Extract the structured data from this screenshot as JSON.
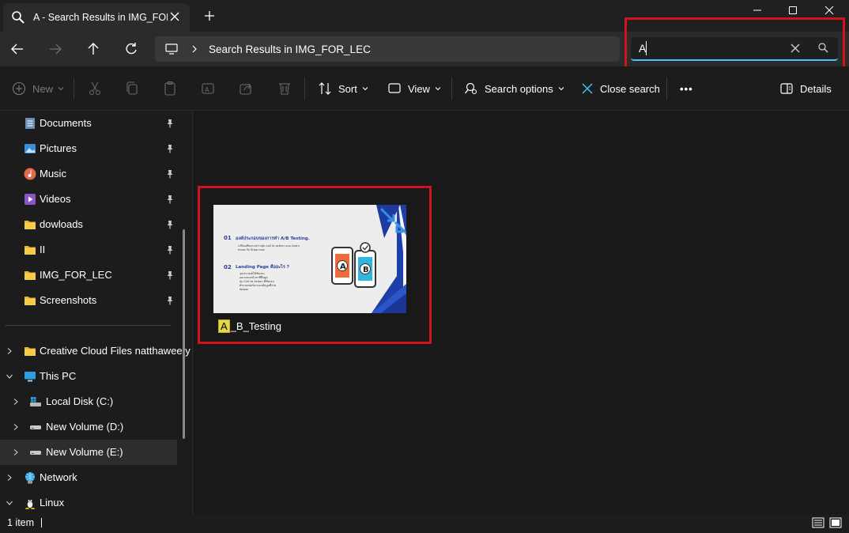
{
  "window": {
    "tab_title": "A - Search Results in IMG_FOR",
    "controls": [
      "minimize-icon",
      "maximize-icon",
      "close-icon"
    ]
  },
  "address_bar": {
    "path": "Search Results in IMG_FOR_LEC",
    "search_value": "A"
  },
  "command_bar": {
    "new_label": "New",
    "sort_label": "Sort",
    "view_label": "View",
    "search_options_label": "Search options",
    "close_search_label": "Close search",
    "more_label": "•••",
    "details_label": "Details"
  },
  "sidebar": {
    "pinned": [
      {
        "label": "Documents",
        "icon": "documents-icon"
      },
      {
        "label": "Pictures",
        "icon": "pictures-icon"
      },
      {
        "label": "Music",
        "icon": "music-icon"
      },
      {
        "label": "Videos",
        "icon": "videos-icon"
      },
      {
        "label": "dowloads",
        "icon": "folder-icon"
      },
      {
        "label": "II",
        "icon": "folder-icon"
      },
      {
        "label": "IMG_FOR_LEC",
        "icon": "folder-icon"
      },
      {
        "label": "Screenshots",
        "icon": "folder-icon"
      }
    ],
    "tree": [
      {
        "label": "Creative Cloud Files  natthawee.y",
        "icon": "folder-icon"
      },
      {
        "label": "This PC",
        "icon": "pc-icon"
      },
      {
        "label": "Local Disk (C:)",
        "icon": "drive-icon"
      },
      {
        "label": "New Volume (D:)",
        "icon": "drive-icon"
      },
      {
        "label": "New Volume (E:)",
        "icon": "drive-icon"
      },
      {
        "label": "Network",
        "icon": "network-icon"
      },
      {
        "label": "Linux",
        "icon": "linux-icon"
      }
    ]
  },
  "content": {
    "file": {
      "name_highlight": "A",
      "name_rest": "_B_Testing",
      "thumbnail": {
        "item1_num": "01",
        "item1_title": "องค์ประกอบของการทำ A/B Testing.",
        "item1_body_1": "เปรียบเทียบระหว่างปุ่ม call to action แบบ Learn",
        "item1_body_2": "more กับ Shop now",
        "item2_num": "02",
        "item2_title": "Landing Page คืออะไร ?",
        "bullets": [
          "จุดประสงค์ให้ชัดเจน",
          "ออกแบบหน้าตาที่ดึงดูด",
          "ปุ่ม Call to Action ที่ชัดเจน",
          "ทำแบบฟอร์มกรอกข้อมูลที่ง่าย",
          "ทดสอบ"
        ],
        "phone_a": "A",
        "phone_b": "B"
      }
    }
  },
  "status": {
    "count": "1 item"
  }
}
